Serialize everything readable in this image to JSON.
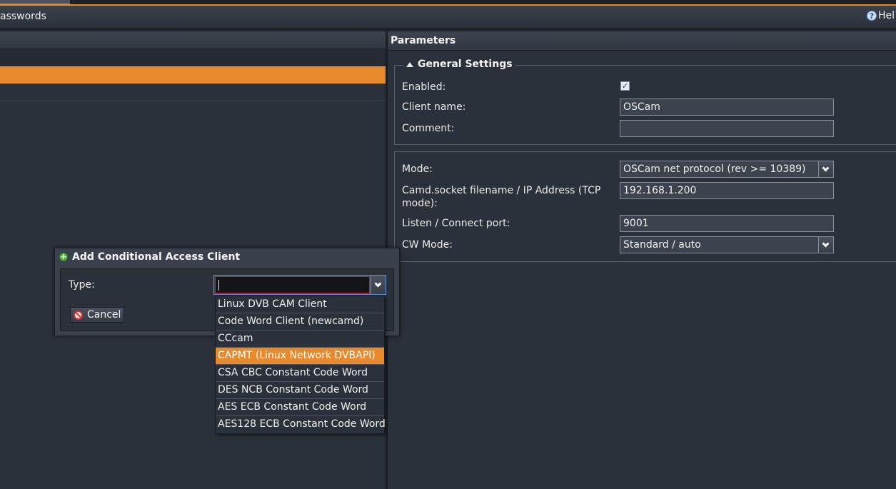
{
  "toolbar": {
    "left_text": "asswords",
    "help_label": "Hel"
  },
  "parameters": {
    "header": "Parameters",
    "general_settings": {
      "legend": "General Settings",
      "enabled_label": "Enabled:",
      "enabled_checked": true,
      "client_name_label": "Client name:",
      "client_name_value": "OSCam",
      "comment_label": "Comment:",
      "comment_value": ""
    },
    "connection": {
      "mode_label": "Mode:",
      "mode_value": "OSCam net protocol (rev >= 10389)",
      "socket_label": "Camd.socket filename / IP Address (TCP mode):",
      "socket_value": "192.168.1.200",
      "port_label": "Listen / Connect port:",
      "port_value": "9001",
      "cw_label": "CW Mode:",
      "cw_value": "Standard / auto"
    }
  },
  "dialog": {
    "title": "Add Conditional Access Client",
    "type_label": "Type:",
    "type_value": "",
    "cancel_label": "Cancel"
  },
  "type_options": [
    "Linux DVB CAM Client",
    "Code Word Client (newcamd)",
    "CCcam",
    "CAPMT (Linux Network DVBAPI)",
    "CSA CBC Constant Code Word",
    "DES NCB Constant Code Word",
    "AES ECB Constant Code Word",
    "AES128 ECB Constant Code Word"
  ],
  "type_highlighted": "CAPMT (Linux Network DVBAPI)",
  "colors": {
    "accent": "#e88a2c",
    "background": "#2b313b"
  }
}
